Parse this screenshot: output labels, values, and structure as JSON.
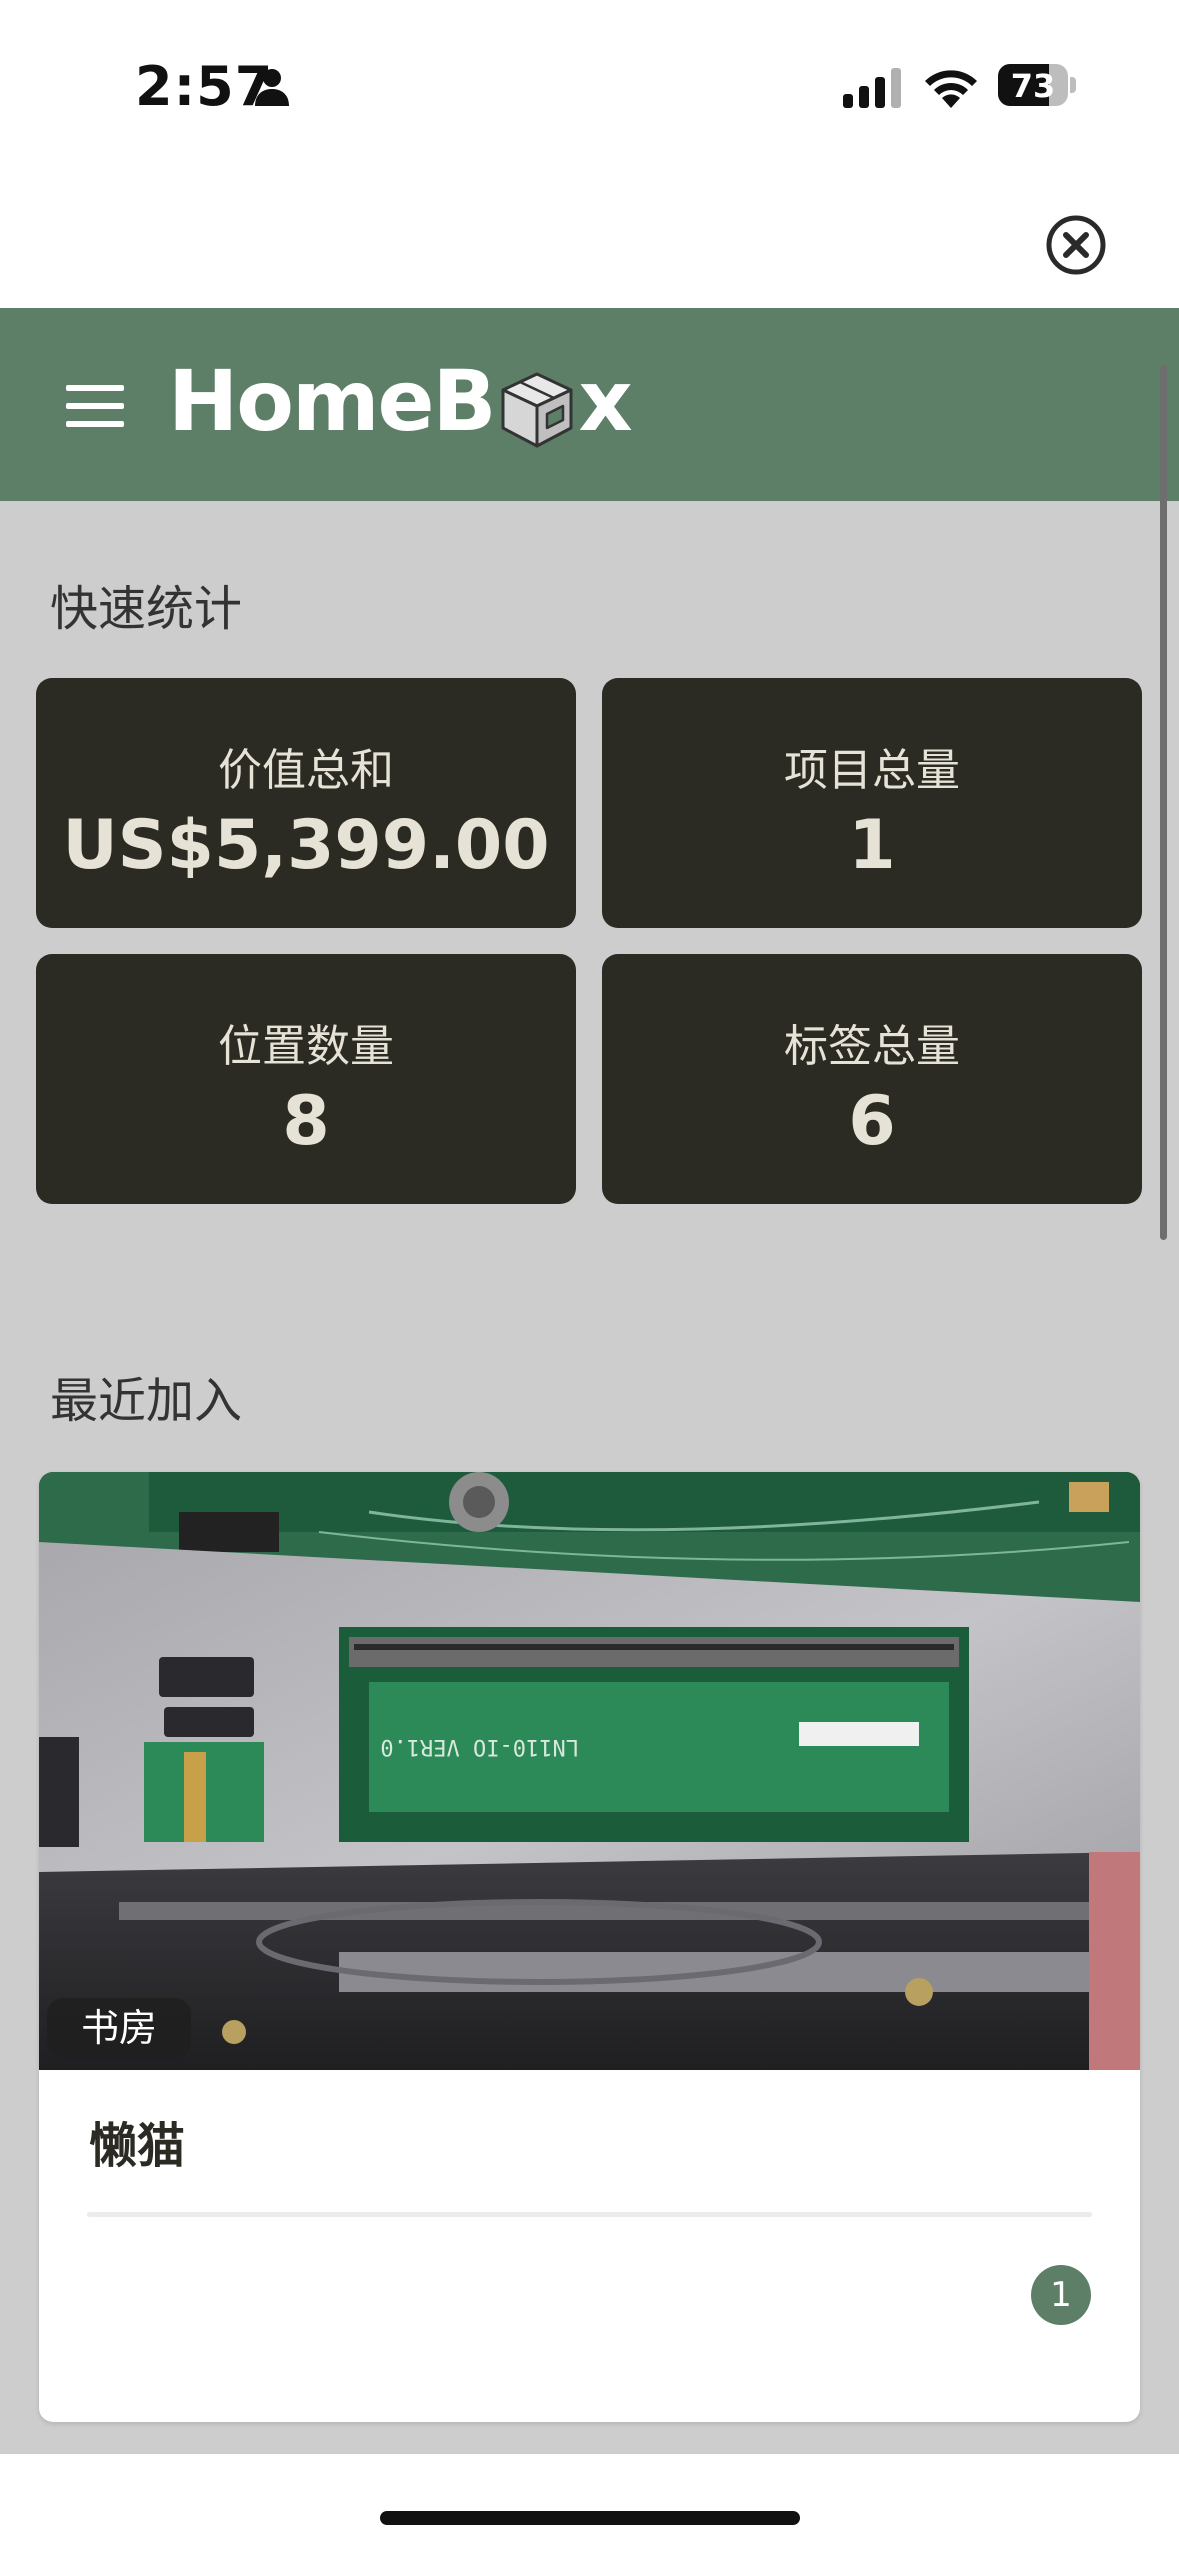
{
  "status_bar": {
    "time": "2:57",
    "battery": "73",
    "battery_level": 0.73,
    "icons": [
      "person-icon",
      "signal-icon",
      "wifi-icon",
      "battery-icon"
    ]
  },
  "header": {
    "logo_left": "HomeB",
    "logo_right": "x",
    "menu_icon": "hamburger-menu-icon",
    "logo_icon": "box-icon",
    "color": "#5e7f67"
  },
  "close_icon": "close-circle-icon",
  "quick_stats": {
    "title": "快速统计",
    "cards": [
      {
        "label": "价值总和",
        "value": "US$5,399.00"
      },
      {
        "label": "项目总量",
        "value": "1"
      },
      {
        "label": "位置数量",
        "value": "8"
      },
      {
        "label": "标签总量",
        "value": "6"
      }
    ],
    "card_color": "#2b2b24"
  },
  "recent": {
    "title": "最近加入",
    "items": [
      {
        "location": "书房",
        "name": "懒猫",
        "quantity": "1",
        "photo_text": "LN110-IO VER1.0"
      }
    ]
  },
  "colors": {
    "content_bg": "#cdcdcd",
    "accent": "#5e7f67"
  }
}
